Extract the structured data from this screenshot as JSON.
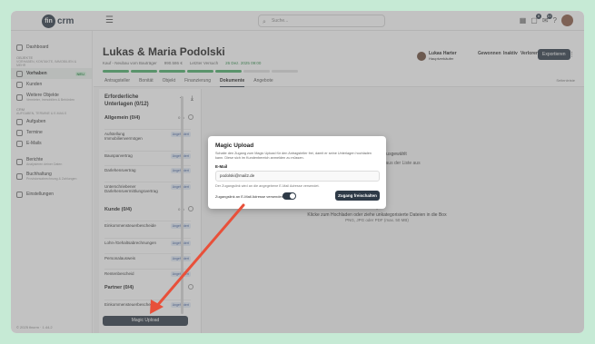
{
  "topbar": {
    "logo_mark": "fin",
    "logo_text": "crm",
    "search_placeholder": "Suche...",
    "notification_count": "8",
    "message_count": "10"
  },
  "sidebar": {
    "items": [
      {
        "label": "Dashboard"
      },
      {
        "label": "Vorhaben",
        "tag": "NEU"
      },
      {
        "label": "Kunden"
      },
      {
        "label": "Weitere Objekte",
        "sub": "Vermieter, Immobilien & Behörden"
      },
      {
        "label": "Aufgaben"
      },
      {
        "label": "Termine"
      },
      {
        "label": "E-Mails"
      },
      {
        "label": "Berichte",
        "sub": "Analysieren deiner Daten"
      },
      {
        "label": "Buchhaltung",
        "sub": "Provisionsabrechnung & Zahlungen"
      },
      {
        "label": "Einstellungen"
      }
    ],
    "section_objects": "OBJEKTE",
    "section_objects_sub": "Vorhaben, Kontakte, Immobilien & mehr",
    "section_crm": "CRM",
    "section_crm_sub": "Aufgaben, Termine & E-Mails",
    "footer": "© 2025 fincrm · 1.44.2"
  },
  "deal": {
    "title": "Lukas & Maria Podolski",
    "type": "Kauf - Neubau vom Bauträger",
    "amount": "990.586 €",
    "last": "Letzter Versuch",
    "date": "26 Dez. 2025 09:00",
    "progress_done": 5,
    "progress_total": 7,
    "owner_name": "Lukas Harter",
    "owner_role": "Hauptverkäufer",
    "btn_won": "Gewonnen",
    "btn_inactive": "Inaktiv",
    "btn_lost": "Verloren",
    "btn_export": "Exportieren"
  },
  "tabs": [
    {
      "label": "Antragsteller"
    },
    {
      "label": "Bonität"
    },
    {
      "label": "Objekt"
    },
    {
      "label": "Finanzierung"
    },
    {
      "label": "Dokumente",
      "active": true
    },
    {
      "label": "Angebote"
    }
  ],
  "tabs_right": "Seitenleiste",
  "docs": {
    "title": "Erforderliche Unterlagen (0/12)",
    "categories": [
      {
        "label": "Allgemein (0/4)",
        "pct": "0 %"
      },
      {
        "label": "Kunde (0/4)",
        "pct": "0 %"
      },
      {
        "label": "Partner (0/4)",
        "pct": ""
      }
    ],
    "items": [
      {
        "label": "Aufstellung Immobilienvermögen",
        "status": "Angefordert"
      },
      {
        "label": "Bausparvertrag",
        "status": "Angefordert"
      },
      {
        "label": "Darlehensvertrag",
        "status": "Angefordert"
      },
      {
        "label": "Unterschriebener Darlehensvermittlungsvertrag",
        "status": "Angefordert"
      },
      {
        "label": "Einkommensteuerbescheide",
        "status": "Angefordert"
      },
      {
        "label": "Lohn-/Gehaltsabrechnungen",
        "status": "Angefordert"
      },
      {
        "label": "Personalausweis",
        "status": "Angefordert"
      },
      {
        "label": "Rentenbescheid",
        "status": "Angefordert"
      },
      {
        "label": "Einkommensteuerbescheide",
        "status": "Angefordert"
      }
    ],
    "magic_button": "Magic Upload"
  },
  "content": {
    "selected_hint": "ment ausgewählt",
    "selected_hint2": "ment aus der Liste aus",
    "upload_main": "Klicke zum Hochladen oder ziehe unkategorisierte Dateien in die Box",
    "upload_sub": "PNG, JPG oder PDF (max. 50 MB)"
  },
  "modal": {
    "title": "Magic Upload",
    "description": "Schalte den Zugang zum Magic Upload für den Antragsteller frei, damit er seine Unterlagen hochladen kann. Diese sich im Kundenbereich anmelden zu müssen.",
    "email_label": "E-Mail",
    "email_value": "podolski@mail2.de",
    "note": "Der Zugangslink wird an die angegebene E-Mail Adresse versendet.",
    "toggle_label": "Zugangslink an E-Mail Adresse versenden",
    "toggle_on": true,
    "confirm_button": "Zugang freischalten"
  },
  "colors": {
    "background": "#c6ead5",
    "primary": "#2e3a47",
    "accent_green": "#4caf6a",
    "arrow": "#e8503a"
  }
}
